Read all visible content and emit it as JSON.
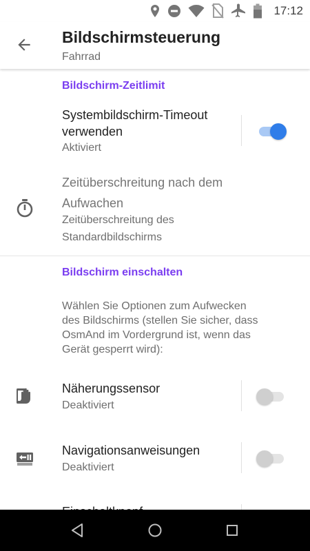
{
  "status_bar": {
    "time": "17:12",
    "icons": [
      "location-icon",
      "do-not-disturb-icon",
      "wifi-icon",
      "no-sim-icon",
      "airplane-icon",
      "battery-icon"
    ]
  },
  "header": {
    "title": "Bildschirmsteuerung",
    "subtitle": "Fahrrad"
  },
  "sections": {
    "screen_timeout": {
      "header": "Bildschirm-Zeitlimit",
      "system_timeout": {
        "title_line1": "Systembildschirm-Timeout",
        "title_line2": "verwenden",
        "status": "Aktiviert",
        "enabled": true
      },
      "wake_timeout": {
        "title_line1": "Zeitüberschreitung nach dem",
        "title_line2": "Aufwachen",
        "sub_line1": "Zeitüberschreitung des",
        "sub_line2": "Standardbildschirms"
      }
    },
    "turn_screen_on": {
      "header": "Bildschirm einschalten",
      "description": [
        "Wählen Sie Optionen zum Aufwecken",
        "des Bildschirms (stellen Sie sicher, dass",
        "OsmAnd im Vordergrund ist, wenn das",
        "Gerät gesperrt wird):"
      ],
      "proximity": {
        "title": "Näherungssensor",
        "status": "Deaktiviert",
        "enabled": false
      },
      "navigation": {
        "title": "Navigationsanweisungen",
        "status": "Deaktiviert",
        "enabled": false
      },
      "power_button": {
        "title": "Einschaltknopf"
      }
    }
  },
  "colors": {
    "accent_purple": "#7a3df0",
    "toggle_on": "#2f7de9",
    "toggle_off": "#cfcfcf",
    "nav_bar": "#000000"
  }
}
